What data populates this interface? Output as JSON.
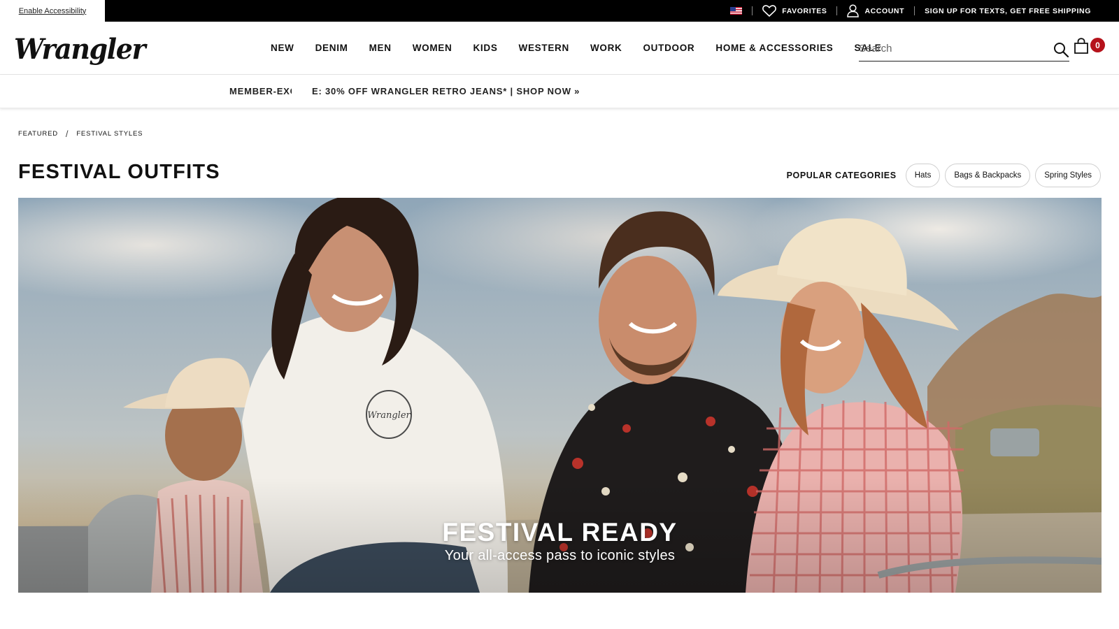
{
  "utility": {
    "accessibility_label": "Enable Accessibility",
    "favorites_label": "FAVORITES",
    "account_label": "ACCOUNT",
    "promo_label": "SIGN UP FOR TEXTS, GET FREE SHIPPING",
    "flag_icon": "us-flag-icon"
  },
  "header": {
    "logo_text": "Wrangler",
    "nav": [
      {
        "label": "NEW"
      },
      {
        "label": "DENIM"
      },
      {
        "label": "MEN"
      },
      {
        "label": "WOMEN"
      },
      {
        "label": "KIDS"
      },
      {
        "label": "WESTERN"
      },
      {
        "label": "WORK"
      },
      {
        "label": "OUTDOOR"
      },
      {
        "label": "HOME & ACCESSORIES"
      },
      {
        "label": "SALE"
      }
    ],
    "search_placeholder": "Search",
    "search_value": "",
    "cart_count": "0",
    "cart_badge_color": "#b5121b"
  },
  "promo_bar": {
    "text_left": "MEMBER-EXCL",
    "text_right": "E: 30% OFF WRANGLER RETRO JEANS* | SHOP NOW »"
  },
  "breadcrumb": {
    "items": [
      "FEATURED",
      "FESTIVAL STYLES"
    ],
    "separator": "/"
  },
  "page": {
    "title": "FESTIVAL OUTFITS",
    "popular_label": "POPULAR CATEGORIES",
    "chips": [
      "Hats",
      "Bags & Backpacks",
      "Spring Styles"
    ]
  },
  "hero": {
    "title": "FESTIVAL READY",
    "subtitle": "Your all-access pass to iconic styles",
    "tee_print": "Wrangler"
  }
}
